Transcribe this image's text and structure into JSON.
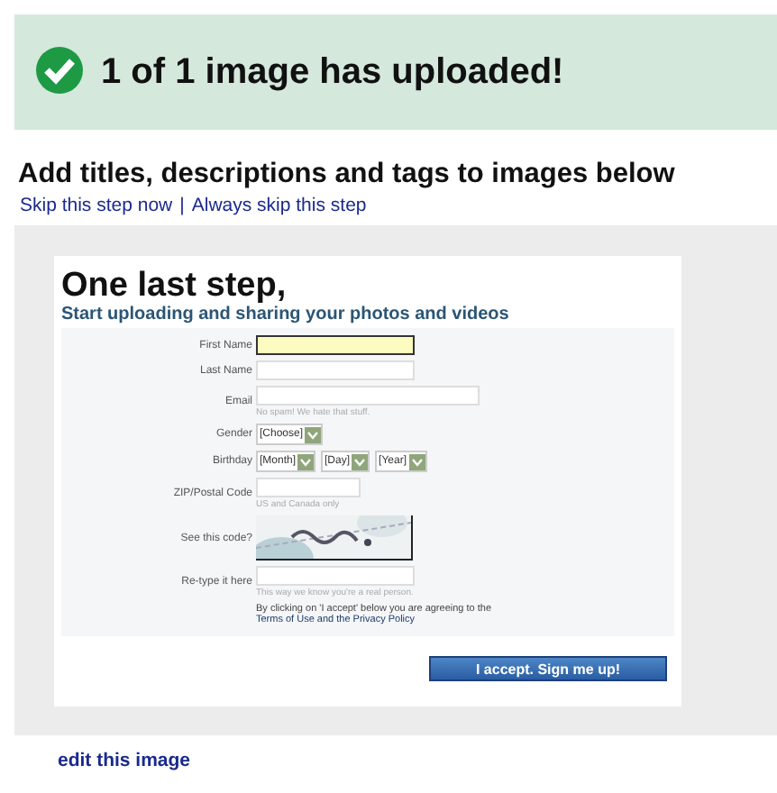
{
  "banner": {
    "title": "1 of 1 image has uploaded!"
  },
  "heading": "Add titles, descriptions and tags to images below",
  "skip_links": [
    "Skip this step now",
    "Always skip this step"
  ],
  "skip_separator": "|",
  "signup": {
    "title": "One last step,",
    "subtitle": "Start uploading and sharing your photos and videos",
    "fields": [
      {
        "kind": "text",
        "label": "First Name",
        "focused": true
      },
      {
        "kind": "text",
        "label": "Last Name",
        "focused": false
      },
      {
        "kind": "text",
        "label": "Email",
        "focused": false,
        "hint": "No spam! We hate that stuff."
      },
      {
        "kind": "select",
        "label": "Gender",
        "selects": [
          "[Choose]"
        ]
      },
      {
        "kind": "select",
        "label": "Birthday",
        "selects": [
          "[Month]",
          "[Day]",
          "[Year]"
        ]
      },
      {
        "kind": "text",
        "label": "ZIP/Postal Code",
        "focused": false,
        "hint": "US and Canada only"
      },
      {
        "kind": "captcha",
        "label": "See this code?"
      },
      {
        "kind": "text",
        "label": "Re-type it here",
        "focused": false,
        "hint": "This way we know you're a real person."
      }
    ],
    "consent": "By clicking on 'I accept' below you are agreeing to the",
    "terms_link": "Terms of Use and the Privacy Policy",
    "submit": "I accept. Sign me up!"
  },
  "edit_link": "edit this image"
}
